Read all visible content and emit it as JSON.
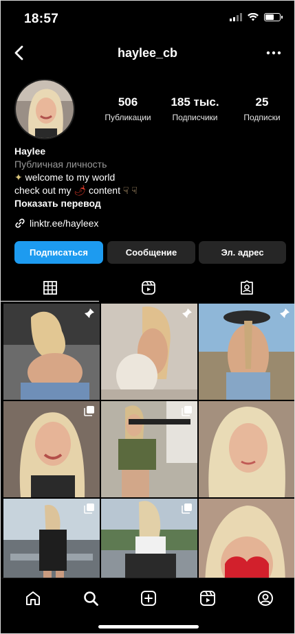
{
  "status_bar": {
    "time": "18:57"
  },
  "header": {
    "username": "haylee_cb"
  },
  "profile": {
    "stats": [
      {
        "value": "506",
        "label": "Публикации"
      },
      {
        "value": "185 тыс.",
        "label": "Подписчики"
      },
      {
        "value": "25",
        "label": "Подписки"
      }
    ],
    "name": "Haylee",
    "category": "Публичная личность",
    "bio_line1": "welcome to my world",
    "bio_line2": "check out my",
    "bio_line2_end": "content",
    "translate": "Показать перевод",
    "link": "linktr.ee/hayleex"
  },
  "buttons": {
    "follow": "Подписаться",
    "message": "Сообщение",
    "email": "Эл. адрес"
  },
  "tabs": [
    "grid-icon",
    "reels-icon",
    "tagged-icon"
  ],
  "grid": [
    {
      "badge": "pin-icon"
    },
    {
      "badge": "pin-icon"
    },
    {
      "badge": "pin-icon"
    },
    {
      "badge": "carousel-icon"
    },
    {
      "badge": "carousel-icon"
    },
    {
      "badge": ""
    },
    {
      "badge": "carousel-icon"
    },
    {
      "badge": "carousel-icon"
    },
    {
      "badge": ""
    }
  ],
  "bottom_nav": [
    "home-icon",
    "search-icon",
    "create-icon",
    "reels-icon",
    "profile-icon"
  ]
}
